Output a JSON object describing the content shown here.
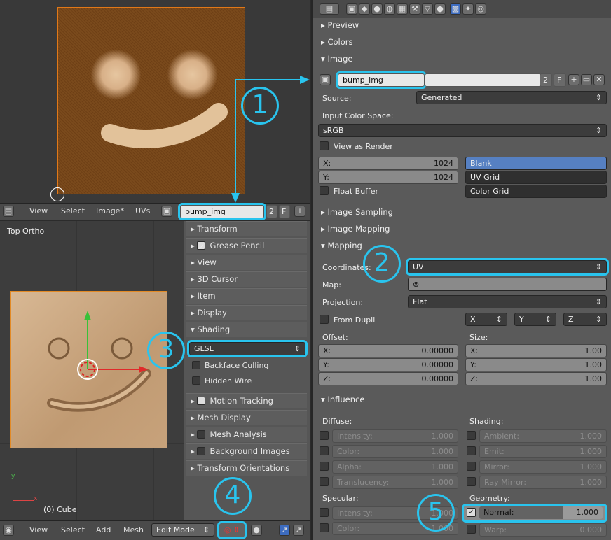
{
  "image_editor": {
    "image_name": "bump_img",
    "users": "2",
    "fake_user": "F",
    "menus": [
      "View",
      "Select",
      "Image*",
      "UVs"
    ]
  },
  "view3d": {
    "label": "Top Ortho",
    "object": "(0) Cube",
    "axis_y": "y",
    "axis_x": "x",
    "menus": [
      "View",
      "Select",
      "Add",
      "Mesh"
    ],
    "mode": "Edit Mode"
  },
  "npanel": {
    "items": [
      "Transform",
      "Grease Pencil",
      "View",
      "3D Cursor",
      "Item",
      "Display",
      "Shading"
    ],
    "shading_mode": "GLSL",
    "backface": "Backface Culling",
    "hidden_wire": "Hidden Wire",
    "items2": [
      "Motion Tracking",
      "Mesh Display",
      "Mesh Analysis",
      "Background Images",
      "Transform Orientations"
    ]
  },
  "props": {
    "sections_top": [
      "Preview",
      "Colors",
      "Image"
    ],
    "image_name": "bump_img",
    "users": "2",
    "fake": "F",
    "source_label": "Source:",
    "source": "Generated",
    "color_space_label": "Input Color Space:",
    "color_space": "sRGB",
    "view_as_render": "View as Render",
    "x_label": "X:",
    "x_val": "1024",
    "y_label": "Y:",
    "y_val": "1024",
    "gen_types": [
      "Blank",
      "UV Grid",
      "Color Grid"
    ],
    "float_buffer": "Float Buffer",
    "sections_mid": [
      "Image Sampling",
      "Image Mapping",
      "Mapping"
    ],
    "coords_label": "Coordinates:",
    "coords": "UV",
    "map_label": "Map:",
    "proj_label": "Projection:",
    "proj": "Flat",
    "from_dupli": "From Dupli",
    "axes": [
      "X",
      "Y",
      "Z"
    ],
    "offset_label": "Offset:",
    "size_label": "Size:",
    "offset": [
      {
        "l": "X:",
        "v": "0.00000"
      },
      {
        "l": "Y:",
        "v": "0.00000"
      },
      {
        "l": "Z:",
        "v": "0.00000"
      }
    ],
    "size": [
      {
        "l": "X:",
        "v": "1.00"
      },
      {
        "l": "Y:",
        "v": "1.00"
      },
      {
        "l": "Z:",
        "v": "1.00"
      }
    ],
    "influence": "Influence",
    "diffuse_label": "Diffuse:",
    "shading_label": "Shading:",
    "diffuse": [
      {
        "l": "Intensity:",
        "v": "1.000"
      },
      {
        "l": "Color:",
        "v": "1.000"
      },
      {
        "l": "Alpha:",
        "v": "1.000"
      },
      {
        "l": "Translucency:",
        "v": "1.000"
      }
    ],
    "shading": [
      {
        "l": "Ambient:",
        "v": "1.000"
      },
      {
        "l": "Emit:",
        "v": "1.000"
      },
      {
        "l": "Mirror:",
        "v": "1.000"
      },
      {
        "l": "Ray Mirror:",
        "v": "1.000"
      }
    ],
    "specular_label": "Specular:",
    "geometry_label": "Geometry:",
    "specular": [
      {
        "l": "Intensity:",
        "v": "1.000"
      },
      {
        "l": "Color:",
        "v": "1.000"
      }
    ],
    "geometry": [
      {
        "l": "Normal:",
        "v": "1.000"
      },
      {
        "l": "Warp:",
        "v": "0.000"
      }
    ]
  },
  "callouts": [
    "1",
    "2",
    "3",
    "4",
    "5"
  ],
  "colors": {
    "highlight": "#29c4ee",
    "selected_blue": "#5680c2",
    "cube_edge": "#e38a25"
  }
}
